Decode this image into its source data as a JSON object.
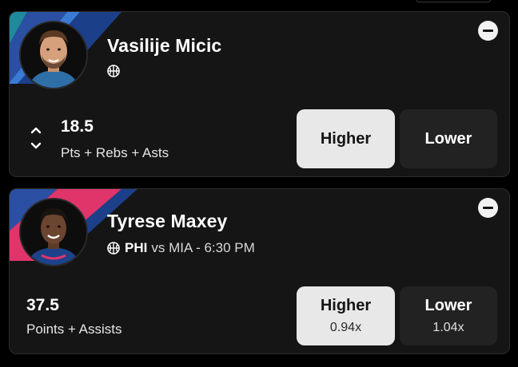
{
  "colors": {
    "background": "#000000",
    "card": "#151515",
    "card_border": "#2c2c2c",
    "higher_selected": "#e8e8e8",
    "lower_unselected": "#222222",
    "stripe_teal": "#1f8a9b",
    "stripe_pink": "#e0356b",
    "stripe_blue": "#2a4fa3"
  },
  "picks": [
    {
      "player_name": "Vasilije Micic",
      "sport_icon": "basketball-icon",
      "matchup": {
        "team": "",
        "vs": ""
      },
      "line_value": "18.5",
      "stat_label": "Pts + Rebs + Asts",
      "adjust_icon": "chevron-up-down-icon",
      "remove_icon": "minus-circle-icon",
      "higher": {
        "label": "Higher",
        "multiplier": "",
        "selected": true
      },
      "lower": {
        "label": "Lower",
        "multiplier": "",
        "selected": false
      }
    },
    {
      "player_name": "Tyrese Maxey",
      "sport_icon": "basketball-icon",
      "matchup": {
        "team": "PHI",
        "vs": "vs MIA - 6:30 PM"
      },
      "line_value": "37.5",
      "stat_label": "Points + Assists",
      "remove_icon": "minus-circle-icon",
      "higher": {
        "label": "Higher",
        "multiplier": "0.94x",
        "selected": true
      },
      "lower": {
        "label": "Lower",
        "multiplier": "1.04x",
        "selected": false
      }
    }
  ]
}
